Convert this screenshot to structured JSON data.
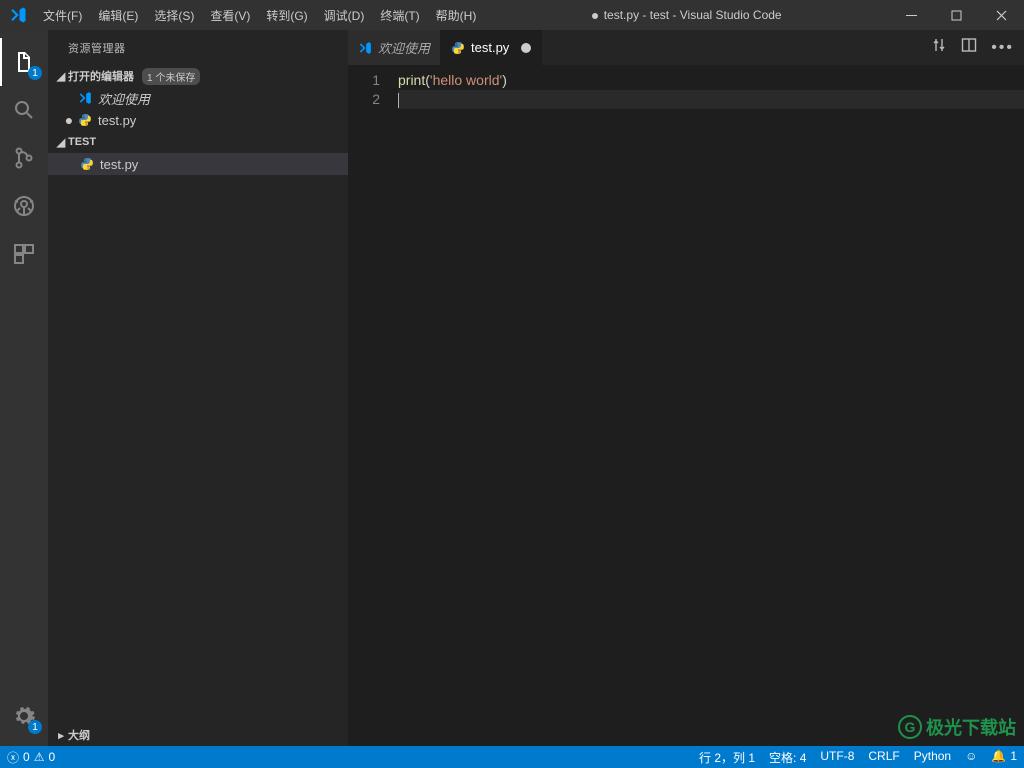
{
  "window": {
    "title": "test.py - test - Visual Studio Code",
    "modified_indicator": "●"
  },
  "menu": [
    "文件(F)",
    "编辑(E)",
    "选择(S)",
    "查看(V)",
    "转到(G)",
    "调试(D)",
    "终端(T)",
    "帮助(H)"
  ],
  "activity": {
    "explorer_badge": "1",
    "settings_badge": "1"
  },
  "sidebar": {
    "title": "资源管理器",
    "open_editors": {
      "label": "打开的编辑器",
      "badge": "1 个未保存",
      "items": [
        {
          "icon": "vscode",
          "label": "欢迎使用",
          "dirty": false,
          "selected": false
        },
        {
          "icon": "python",
          "label": "test.py",
          "dirty": true,
          "selected": false
        }
      ]
    },
    "folder": {
      "label": "TEST",
      "items": [
        {
          "icon": "python",
          "label": "test.py",
          "selected": true,
          "dirty": false
        }
      ]
    },
    "outline": {
      "label": "大纲"
    }
  },
  "tabs": [
    {
      "icon": "vscode",
      "label": "欢迎使用",
      "dirty": false,
      "active": false,
      "italic": true
    },
    {
      "icon": "python",
      "label": "test.py",
      "dirty": true,
      "active": true,
      "italic": false
    }
  ],
  "code": {
    "lines": [
      {
        "n": "1",
        "tokens": [
          {
            "t": "print",
            "c": "tok-fn"
          },
          {
            "t": "(",
            "c": "tok-punc"
          },
          {
            "t": "'hello world'",
            "c": "tok-str"
          },
          {
            "t": ")",
            "c": "tok-punc"
          }
        ]
      },
      {
        "n": "2",
        "tokens": []
      }
    ]
  },
  "status": {
    "errors": "0",
    "warnings": "0",
    "cursor": "行 2，列 1",
    "spaces": "空格: 4",
    "encoding": "UTF-8",
    "eol": "CRLF",
    "lang": "Python",
    "feedback": "☺",
    "notifications": "1"
  },
  "watermark": "极光下载站"
}
